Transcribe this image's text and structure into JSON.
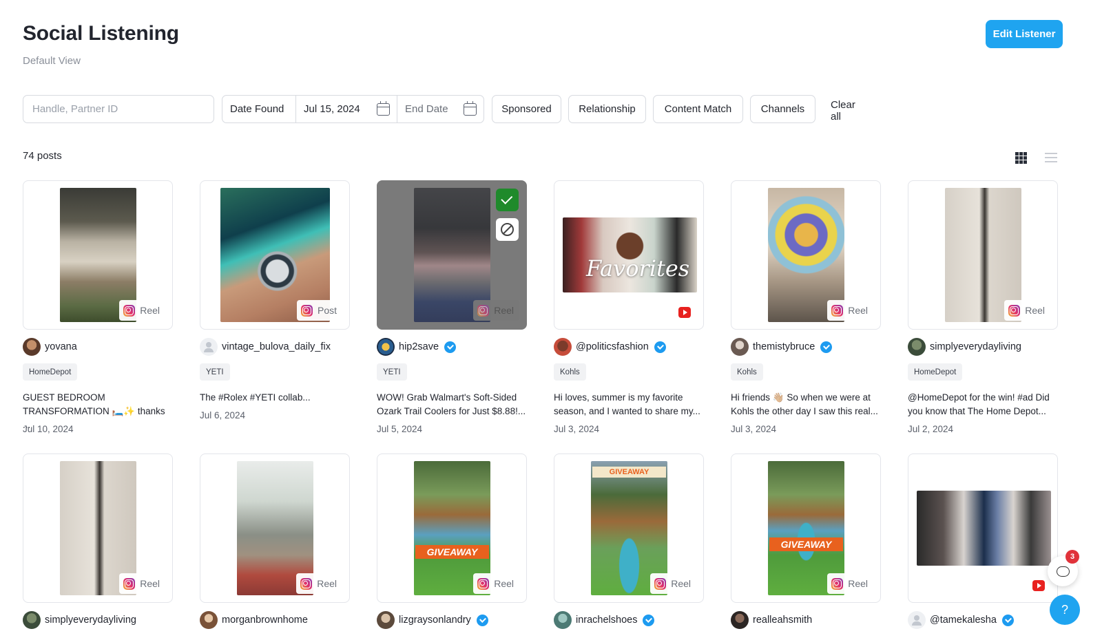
{
  "header": {
    "title": "Social Listening",
    "subtitle": "Default View",
    "edit_button": "Edit Listener"
  },
  "filters": {
    "search_placeholder": "Handle, Partner ID",
    "date_label": "Date Found",
    "start_date": "Jul 15, 2024",
    "end_date_placeholder": "End Date",
    "chips": [
      "Sponsored",
      "Relationship",
      "Content Match",
      "Channels"
    ],
    "clear_all": "Clear all"
  },
  "results": {
    "count_label": "74 posts",
    "view_mode": "grid"
  },
  "posts": [
    {
      "handle": "yovana",
      "verified": false,
      "type": "Reel",
      "platform": "instagram",
      "tag": "HomeDepot",
      "caption": "GUEST BEDROOM TRANSFORMATION 🛏️✨ thanks ...",
      "date": "Jul 10, 2024",
      "selected": false
    },
    {
      "handle": "vintage_bulova_daily_fix",
      "verified": false,
      "type": "Post",
      "platform": "instagram",
      "tag": "YETI",
      "caption": "The #Rolex #YETI collab...",
      "date": "Jul 6, 2024",
      "selected": false
    },
    {
      "handle": "hip2save",
      "verified": true,
      "type": "Reel",
      "platform": "instagram",
      "tag": "YETI",
      "caption": "WOW! Grab Walmart's Soft-Sided Ozark Trail Coolers for Just $8.88!...",
      "date": "Jul 5, 2024",
      "selected": true
    },
    {
      "handle": "@politicsfashion",
      "verified": true,
      "type": "",
      "platform": "youtube",
      "tag": "Kohls",
      "caption": "Hi loves, summer is my favorite season, and I wanted to share my...",
      "date": "Jul 3, 2024",
      "selected": false
    },
    {
      "handle": "themistybruce",
      "verified": true,
      "type": "Reel",
      "platform": "instagram",
      "tag": "Kohls",
      "caption": "Hi friends 👋🏼 So when we were at Kohls the other day I saw this real...",
      "date": "Jul 3, 2024",
      "selected": false
    },
    {
      "handle": "simplyeverydayliving",
      "verified": false,
      "type": "Reel",
      "platform": "instagram",
      "tag": "HomeDepot",
      "caption": "@HomeDepot for the win! #ad Did you know that The Home Depot...",
      "date": "Jul 2, 2024",
      "selected": false
    },
    {
      "handle": "simplyeverydayliving",
      "verified": false,
      "type": "Reel",
      "platform": "instagram"
    },
    {
      "handle": "morganbrownhome",
      "verified": false,
      "type": "Reel",
      "platform": "instagram"
    },
    {
      "handle": "lizgraysonlandry",
      "verified": true,
      "type": "Reel",
      "platform": "instagram"
    },
    {
      "handle": "inrachelshoes",
      "verified": true,
      "type": "Reel",
      "platform": "instagram"
    },
    {
      "handle": "realleahsmith",
      "verified": false,
      "type": "Reel",
      "platform": "instagram"
    },
    {
      "handle": "@tamekalesha",
      "verified": true,
      "type": "",
      "platform": "youtube"
    }
  ],
  "thumb_text": {
    "giveaway": "GIVEAWAY",
    "favorites": "Favorites"
  },
  "widgets": {
    "chat_count": "3",
    "help_label": "?"
  },
  "colors": {
    "accent": "#1fa4f0",
    "verified": "#1d9bf0",
    "approve": "#1f8a2b",
    "youtube": "#e8211f",
    "notification": "#e0323a"
  }
}
